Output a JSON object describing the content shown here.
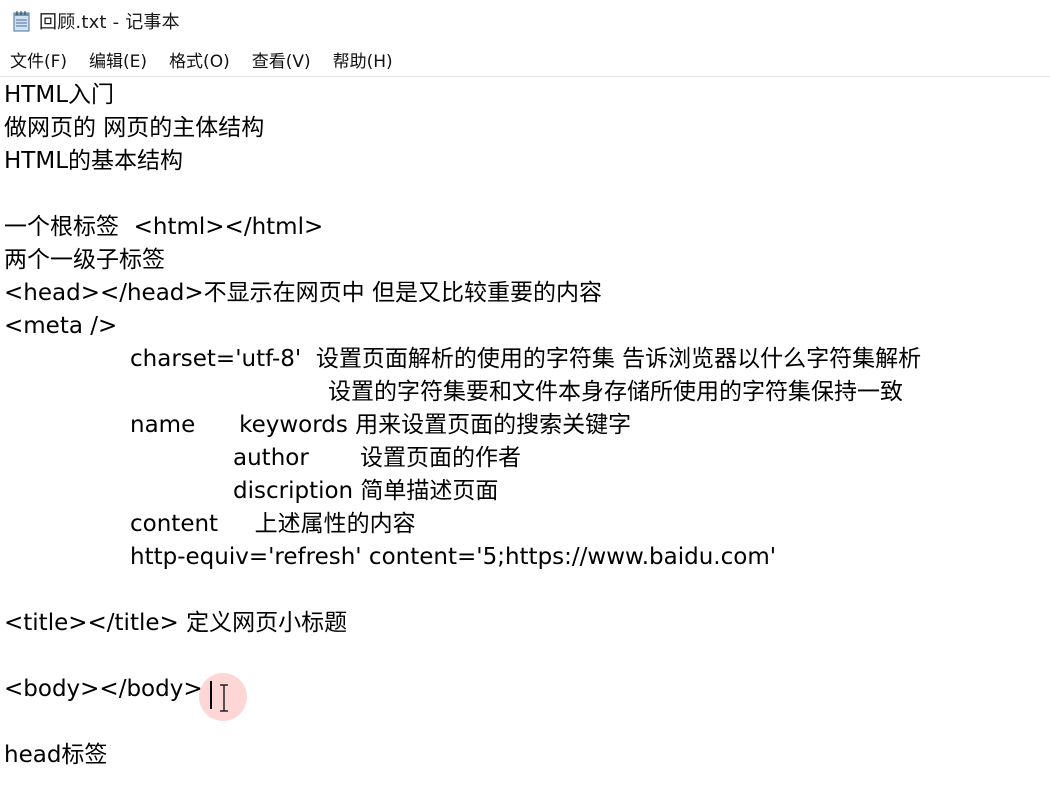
{
  "window": {
    "title": "回顾.txt - 记事本",
    "icon": "notepad-icon"
  },
  "menu": {
    "items": [
      {
        "label": "文件(F)"
      },
      {
        "label": "编辑(E)"
      },
      {
        "label": "格式(O)"
      },
      {
        "label": "查看(V)"
      },
      {
        "label": "帮助(H)"
      }
    ]
  },
  "editor": {
    "lines": [
      "HTML入门",
      "做网页的 网页的主体结构",
      "HTML的基本结构",
      "",
      "一个根标签  <html></html>",
      "两个一级子标签",
      "<head></head>不显示在网页中 但是又比较重要的内容",
      "<meta />",
      "charset='utf-8'  设置页面解析的使用的字符集 告诉浏览器以什么字符集解析",
      "设置的字符集要和文件本身存储所使用的字符集保持一致",
      "name      keywords 用来设置页面的搜索关键字",
      "author       设置页面的作者",
      "discription 简单描述页面",
      "content     上述属性的内容",
      "http-equiv='refresh' content='5;https://www.baidu.com'",
      "",
      "<title></title> 定义网页小标题",
      "",
      "<body></body>",
      "",
      "head标签"
    ]
  },
  "colors": {
    "cursor_highlight": "#ffb4b4"
  }
}
